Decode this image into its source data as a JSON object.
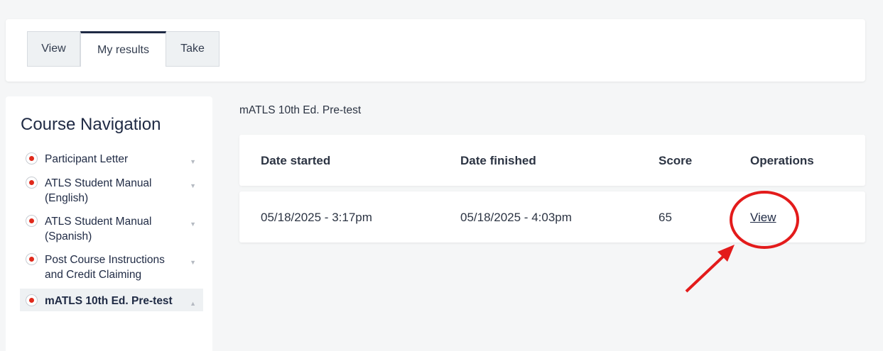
{
  "tabs": [
    {
      "label": "View"
    },
    {
      "label": "My results"
    },
    {
      "label": "Take"
    }
  ],
  "sidebar": {
    "title": "Course Navigation",
    "items": [
      {
        "label": "Participant Letter"
      },
      {
        "label": "ATLS Student Manual (English)"
      },
      {
        "label": "ATLS Student Manual (Spanish)"
      },
      {
        "label": "Post Course Instructions and Credit Claiming"
      },
      {
        "label": "mATLS 10th Ed. Pre-test"
      }
    ]
  },
  "main": {
    "title": "mATLS 10th Ed. Pre-test",
    "table": {
      "headers": [
        "Date started",
        "Date finished",
        "Score",
        "Operations"
      ],
      "rows": [
        {
          "started": "05/18/2025 - 3:17pm",
          "finished": "05/18/2025 - 4:03pm",
          "score": "65",
          "operation": "View"
        }
      ]
    }
  },
  "colors": {
    "accent_red": "#e0291b",
    "annotation_red": "#e31b1b",
    "text_dark": "#1f2a44"
  }
}
